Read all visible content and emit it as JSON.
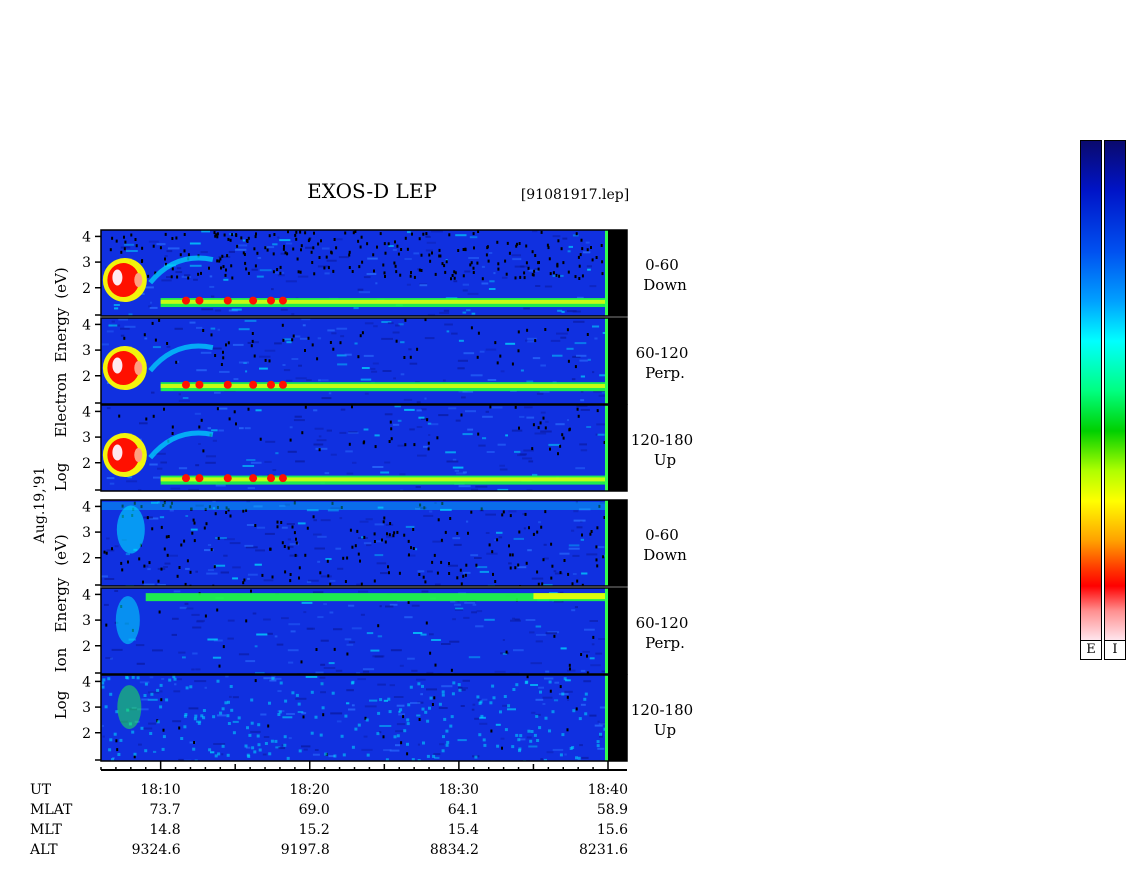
{
  "title": "EXOS-D LEP",
  "file_label": "[91081917.lep]",
  "date_label": "Aug.19,'91",
  "colors": {
    "background_low": "#000000",
    "blue": "#1030e0",
    "cyan": "#00e0ff",
    "green": "#20ff40",
    "yellow": "#ffff00",
    "red": "#ff1000",
    "white": "#ffe8f0",
    "boundary_green": "#30ff50"
  },
  "electron_group": {
    "ylabel_lines": [
      "Log",
      "Electron",
      "Energy"
    ],
    "ylabel_unit": "(eV)"
  },
  "ion_group": {
    "ylabel_lines": [
      "Log",
      "Ion",
      "Energy"
    ],
    "ylabel_unit": "(eV)"
  },
  "panels": [
    {
      "species": "electron",
      "angle": "0-60",
      "direction": "Down"
    },
    {
      "species": "electron",
      "angle": "60-120",
      "direction": "Perp."
    },
    {
      "species": "electron",
      "angle": "120-180",
      "direction": "Up"
    },
    {
      "species": "ion",
      "angle": "0-60",
      "direction": "Down"
    },
    {
      "species": "ion",
      "angle": "60-120",
      "direction": "Perp."
    },
    {
      "species": "ion",
      "angle": "120-180",
      "direction": "Up"
    }
  ],
  "y_ticks": [
    "2",
    "3",
    "4"
  ],
  "x_ticks": [
    "18:10",
    "18:20",
    "18:30",
    "18:40"
  ],
  "ephemeris": {
    "labels": [
      "UT",
      "MLAT",
      "MLT",
      "ALT"
    ],
    "rows": [
      {
        "name": "MLAT",
        "values": [
          "73.7",
          "69.0",
          "64.1",
          "58.9"
        ]
      },
      {
        "name": "MLT",
        "values": [
          "14.8",
          "15.2",
          "15.4",
          "15.6"
        ]
      },
      {
        "name": "ALT",
        "values": [
          "9324.6",
          "9197.8",
          "8834.2",
          "8231.6"
        ]
      }
    ]
  },
  "colorbars": [
    {
      "label": "E"
    },
    {
      "label": "I"
    }
  ],
  "chart_data": {
    "type": "heatmap",
    "title": "EXOS-D LEP",
    "xlabel": "UT",
    "ylabel": "Log Energy (eV)",
    "x_range": [
      "18:06",
      "18:40"
    ],
    "x_ticks": [
      "18:10",
      "18:20",
      "18:30",
      "18:40"
    ],
    "y_range": [
      1,
      4.2
    ],
    "y_ticks": [
      2,
      3,
      4
    ],
    "y_scale": "log10",
    "panels": [
      {
        "name": "Electron 0-60 Down",
        "features": [
          {
            "ut": "18:06-18:10",
            "log_energy": [
              1.8,
              3.0
            ],
            "intensity": "high"
          },
          {
            "ut": "18:10-18:40",
            "log_energy": [
              1.4,
              1.6
            ],
            "intensity": "medium"
          }
        ]
      },
      {
        "name": "Electron 60-120 Perp.",
        "features": [
          {
            "ut": "18:06-18:10",
            "log_energy": [
              1.8,
              3.0
            ],
            "intensity": "high"
          },
          {
            "ut": "18:10-18:40",
            "log_energy": [
              1.5,
              1.7
            ],
            "intensity": "medium"
          }
        ]
      },
      {
        "name": "Electron 120-180 Up",
        "features": [
          {
            "ut": "18:06-18:10",
            "log_energy": [
              1.8,
              3.0
            ],
            "intensity": "high"
          },
          {
            "ut": "18:10-18:40",
            "log_energy": [
              1.3,
              1.5
            ],
            "intensity": "medium"
          }
        ]
      },
      {
        "name": "Ion 0-60 Down",
        "features": [
          {
            "ut": "18:06-18:09",
            "log_energy": [
              2.5,
              4.0
            ],
            "intensity": "medium"
          }
        ]
      },
      {
        "name": "Ion 60-120 Perp.",
        "features": [
          {
            "ut": "18:09-18:40",
            "log_energy": [
              3.8,
              4.0
            ],
            "intensity": "medium"
          }
        ]
      },
      {
        "name": "Ion 120-180 Up",
        "features": [
          {
            "ut": "18:06-18:40",
            "log_energy": [
              1.0,
              4.0
            ],
            "intensity": "low-medium"
          }
        ]
      }
    ]
  }
}
